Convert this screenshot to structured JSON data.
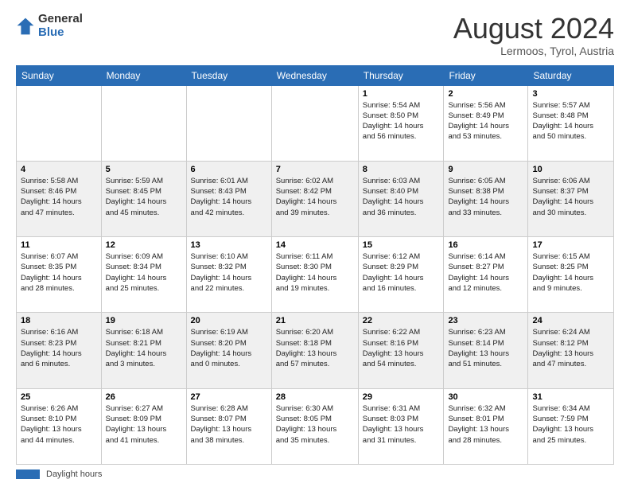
{
  "header": {
    "logo_general": "General",
    "logo_blue": "Blue",
    "month_year": "August 2024",
    "location": "Lermoos, Tyrol, Austria"
  },
  "days_of_week": [
    "Sunday",
    "Monday",
    "Tuesday",
    "Wednesday",
    "Thursday",
    "Friday",
    "Saturday"
  ],
  "footer": {
    "daylight_label": "Daylight hours"
  },
  "weeks": [
    [
      {
        "num": "",
        "info": ""
      },
      {
        "num": "",
        "info": ""
      },
      {
        "num": "",
        "info": ""
      },
      {
        "num": "",
        "info": ""
      },
      {
        "num": "1",
        "info": "Sunrise: 5:54 AM\nSunset: 8:50 PM\nDaylight: 14 hours\nand 56 minutes."
      },
      {
        "num": "2",
        "info": "Sunrise: 5:56 AM\nSunset: 8:49 PM\nDaylight: 14 hours\nand 53 minutes."
      },
      {
        "num": "3",
        "info": "Sunrise: 5:57 AM\nSunset: 8:48 PM\nDaylight: 14 hours\nand 50 minutes."
      }
    ],
    [
      {
        "num": "4",
        "info": "Sunrise: 5:58 AM\nSunset: 8:46 PM\nDaylight: 14 hours\nand 47 minutes."
      },
      {
        "num": "5",
        "info": "Sunrise: 5:59 AM\nSunset: 8:45 PM\nDaylight: 14 hours\nand 45 minutes."
      },
      {
        "num": "6",
        "info": "Sunrise: 6:01 AM\nSunset: 8:43 PM\nDaylight: 14 hours\nand 42 minutes."
      },
      {
        "num": "7",
        "info": "Sunrise: 6:02 AM\nSunset: 8:42 PM\nDaylight: 14 hours\nand 39 minutes."
      },
      {
        "num": "8",
        "info": "Sunrise: 6:03 AM\nSunset: 8:40 PM\nDaylight: 14 hours\nand 36 minutes."
      },
      {
        "num": "9",
        "info": "Sunrise: 6:05 AM\nSunset: 8:38 PM\nDaylight: 14 hours\nand 33 minutes."
      },
      {
        "num": "10",
        "info": "Sunrise: 6:06 AM\nSunset: 8:37 PM\nDaylight: 14 hours\nand 30 minutes."
      }
    ],
    [
      {
        "num": "11",
        "info": "Sunrise: 6:07 AM\nSunset: 8:35 PM\nDaylight: 14 hours\nand 28 minutes."
      },
      {
        "num": "12",
        "info": "Sunrise: 6:09 AM\nSunset: 8:34 PM\nDaylight: 14 hours\nand 25 minutes."
      },
      {
        "num": "13",
        "info": "Sunrise: 6:10 AM\nSunset: 8:32 PM\nDaylight: 14 hours\nand 22 minutes."
      },
      {
        "num": "14",
        "info": "Sunrise: 6:11 AM\nSunset: 8:30 PM\nDaylight: 14 hours\nand 19 minutes."
      },
      {
        "num": "15",
        "info": "Sunrise: 6:12 AM\nSunset: 8:29 PM\nDaylight: 14 hours\nand 16 minutes."
      },
      {
        "num": "16",
        "info": "Sunrise: 6:14 AM\nSunset: 8:27 PM\nDaylight: 14 hours\nand 12 minutes."
      },
      {
        "num": "17",
        "info": "Sunrise: 6:15 AM\nSunset: 8:25 PM\nDaylight: 14 hours\nand 9 minutes."
      }
    ],
    [
      {
        "num": "18",
        "info": "Sunrise: 6:16 AM\nSunset: 8:23 PM\nDaylight: 14 hours\nand 6 minutes."
      },
      {
        "num": "19",
        "info": "Sunrise: 6:18 AM\nSunset: 8:21 PM\nDaylight: 14 hours\nand 3 minutes."
      },
      {
        "num": "20",
        "info": "Sunrise: 6:19 AM\nSunset: 8:20 PM\nDaylight: 14 hours\nand 0 minutes."
      },
      {
        "num": "21",
        "info": "Sunrise: 6:20 AM\nSunset: 8:18 PM\nDaylight: 13 hours\nand 57 minutes."
      },
      {
        "num": "22",
        "info": "Sunrise: 6:22 AM\nSunset: 8:16 PM\nDaylight: 13 hours\nand 54 minutes."
      },
      {
        "num": "23",
        "info": "Sunrise: 6:23 AM\nSunset: 8:14 PM\nDaylight: 13 hours\nand 51 minutes."
      },
      {
        "num": "24",
        "info": "Sunrise: 6:24 AM\nSunset: 8:12 PM\nDaylight: 13 hours\nand 47 minutes."
      }
    ],
    [
      {
        "num": "25",
        "info": "Sunrise: 6:26 AM\nSunset: 8:10 PM\nDaylight: 13 hours\nand 44 minutes."
      },
      {
        "num": "26",
        "info": "Sunrise: 6:27 AM\nSunset: 8:09 PM\nDaylight: 13 hours\nand 41 minutes."
      },
      {
        "num": "27",
        "info": "Sunrise: 6:28 AM\nSunset: 8:07 PM\nDaylight: 13 hours\nand 38 minutes."
      },
      {
        "num": "28",
        "info": "Sunrise: 6:30 AM\nSunset: 8:05 PM\nDaylight: 13 hours\nand 35 minutes."
      },
      {
        "num": "29",
        "info": "Sunrise: 6:31 AM\nSunset: 8:03 PM\nDaylight: 13 hours\nand 31 minutes."
      },
      {
        "num": "30",
        "info": "Sunrise: 6:32 AM\nSunset: 8:01 PM\nDaylight: 13 hours\nand 28 minutes."
      },
      {
        "num": "31",
        "info": "Sunrise: 6:34 AM\nSunset: 7:59 PM\nDaylight: 13 hours\nand 25 minutes."
      }
    ]
  ]
}
